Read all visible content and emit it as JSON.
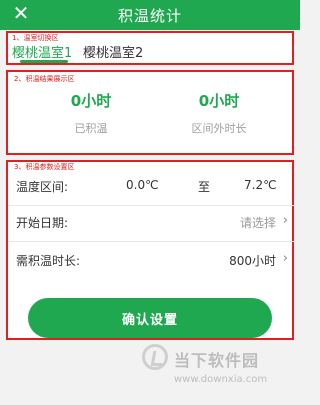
{
  "header": {
    "title": "积温统计",
    "close_icon": "close-icon"
  },
  "annotations": {
    "tabs_label": "1、温室切换区",
    "result_label": "2、积温结果展示区",
    "settings_label": "3、积温参数设置区"
  },
  "tabs": [
    {
      "label": "樱桃温室1",
      "active": true
    },
    {
      "label": "樱桃温室2",
      "active": false
    }
  ],
  "results": {
    "accumulated_value": "0小时",
    "accumulated_label": "已积温",
    "outside_value": "0小时",
    "outside_label": "区间外时长"
  },
  "settings": {
    "temperature": {
      "label": "温度区间:",
      "from": "0.0℃",
      "to_label": "至",
      "to": "7.2℃"
    },
    "start_date": {
      "label": "开始日期:",
      "placeholder": "请选择"
    },
    "duration": {
      "label": "需积温时长:",
      "value": "800小时"
    },
    "confirm_label": "确认设置"
  },
  "watermark": {
    "brand": "当下软件园",
    "url": "www.downxia.com"
  },
  "colors": {
    "brand_green": "#1fa84f",
    "annotation_red": "#e02020"
  }
}
